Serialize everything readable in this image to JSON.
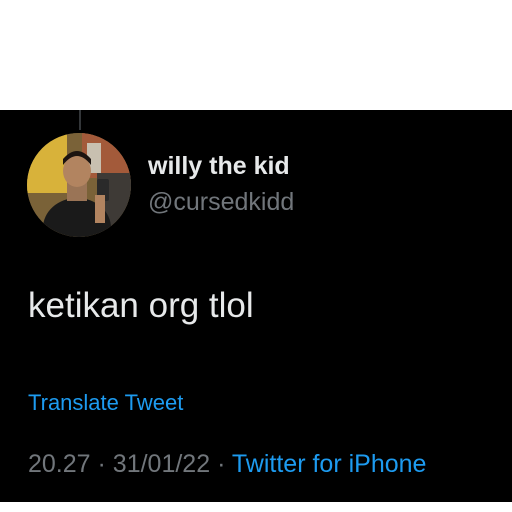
{
  "user": {
    "display_name": "willy the kid",
    "handle": "@cursedkidd"
  },
  "tweet": {
    "text": "ketikan org tlol",
    "translate_label": "Translate Tweet",
    "time": "20.27",
    "separator": "·",
    "date": "31/01/22",
    "source": "Twitter for iPhone"
  },
  "colors": {
    "background": "#000000",
    "primary_text": "#e7e9ea",
    "secondary_text": "#71767b",
    "link": "#1d9bf0"
  }
}
